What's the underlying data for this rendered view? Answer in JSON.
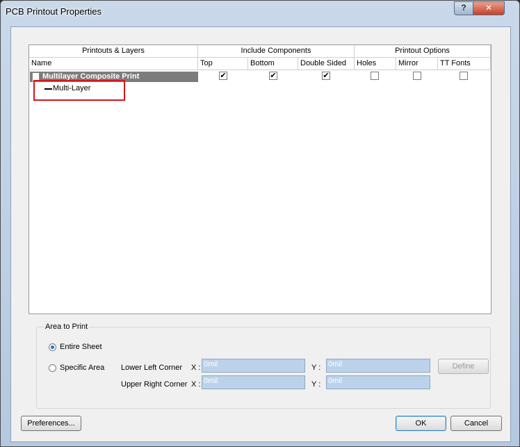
{
  "window": {
    "title": "PCB Printout Properties",
    "help_glyph": "?",
    "close_glyph": "✕"
  },
  "table": {
    "groups": [
      "Printouts & Layers",
      "Include Components",
      "Printout Options"
    ],
    "columns": [
      "Name",
      "Top",
      "Bottom",
      "Double Sided",
      "Holes",
      "Mirror",
      "TT Fonts"
    ],
    "row": {
      "name": "Multilayer Composite Print",
      "checks": {
        "top": "✔",
        "bottom": "✔",
        "double_sided": "✔",
        "holes": "",
        "mirror": "",
        "tt_fonts": ""
      }
    },
    "child": {
      "name": "Multi-Layer"
    }
  },
  "area": {
    "legend": "Area to Print",
    "entire_sheet": "Entire Sheet",
    "specific_area": "Specific Area",
    "lower_left": "Lower Left Corner",
    "upper_right": "Upper Right Corner",
    "x_label": "X :",
    "y_label": "Y :",
    "ll_x": "0mil",
    "ll_y": "0mil",
    "ur_x": "0mil",
    "ur_y": "0mil",
    "define": "Define"
  },
  "buttons": {
    "preferences": "Preferences...",
    "ok": "OK",
    "cancel": "Cancel"
  }
}
